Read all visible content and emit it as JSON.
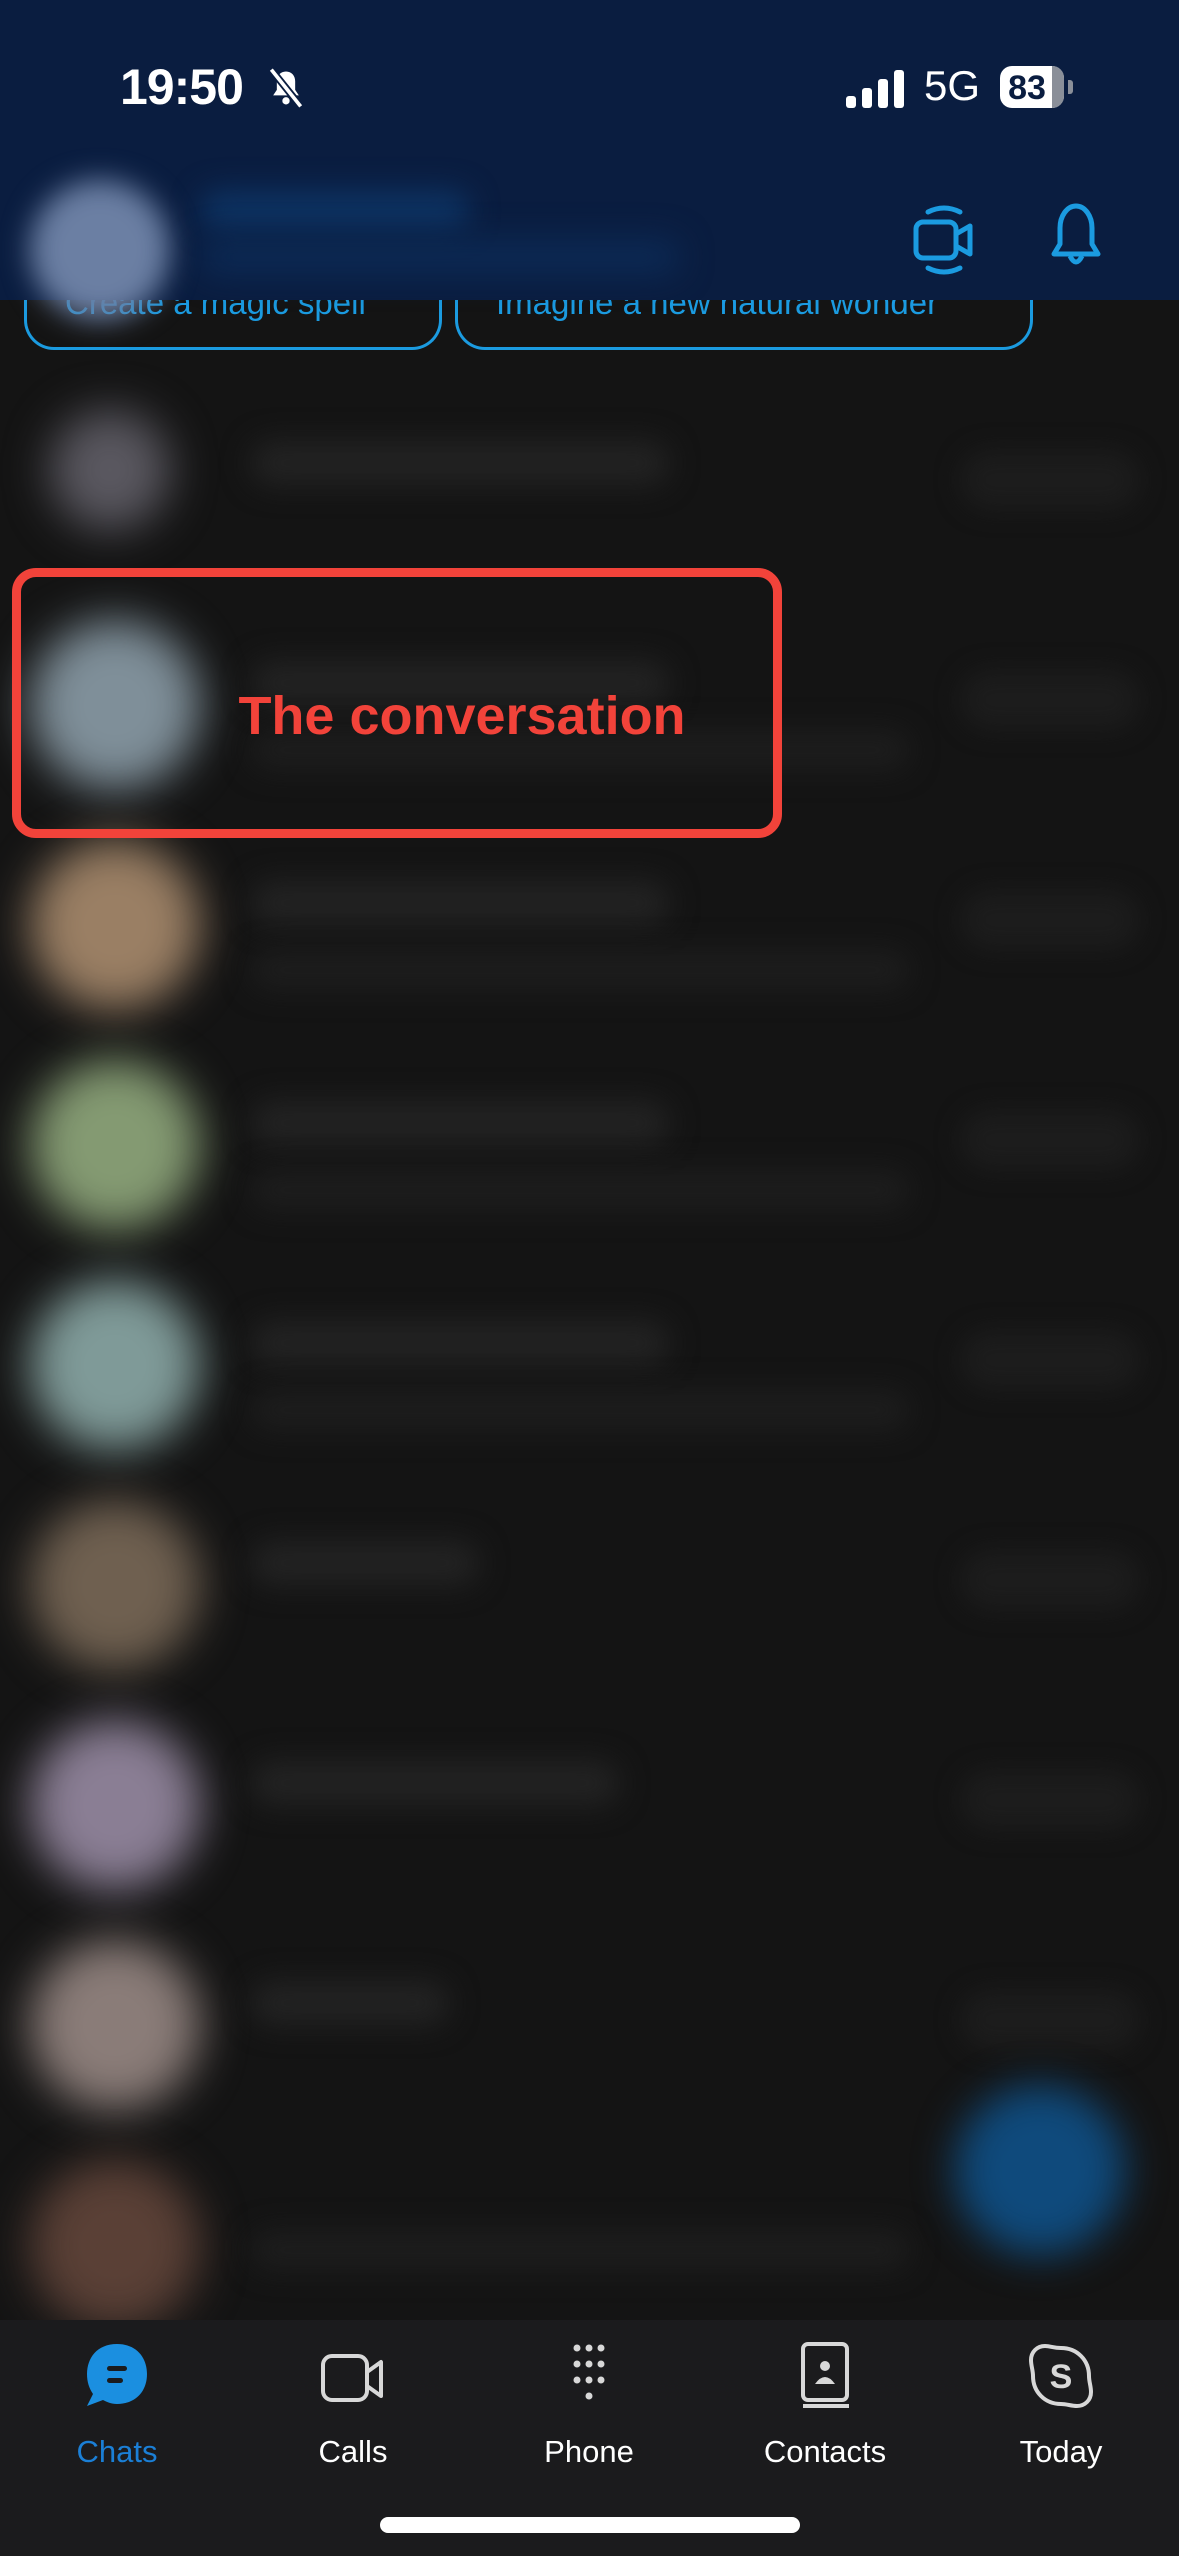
{
  "status_bar": {
    "time": "19:50",
    "silent_mode": true,
    "network": "5G",
    "signal_bars": 4,
    "battery_percent": "83"
  },
  "header": {
    "video_button_icon": "video-camera-ring-icon",
    "notifications_button_icon": "bell-icon"
  },
  "prompt_chips": [
    {
      "label": "Create a magic spell"
    },
    {
      "label": "Imagine a new natural wonder"
    }
  ],
  "chat_list": {
    "rows": [
      {
        "avatar_color": "#5a5860"
      },
      {
        "avatar_color": "#7f8f99"
      },
      {
        "avatar_color": "#9a7f64"
      },
      {
        "avatar_color": "#849a72"
      },
      {
        "avatar_color": "#7f9a98"
      },
      {
        "avatar_color": "#6f6050"
      },
      {
        "avatar_color": "#8a7e94"
      },
      {
        "avatar_color": "#8a7c78"
      },
      {
        "avatar_color": "#5a4036"
      }
    ]
  },
  "annotation": {
    "label": "The conversation",
    "color": "#f2433a"
  },
  "tab_bar": {
    "tabs": [
      {
        "label": "Chats",
        "icon": "chat-bubble-icon",
        "active": true
      },
      {
        "label": "Calls",
        "icon": "video-camera-icon",
        "active": false
      },
      {
        "label": "Phone",
        "icon": "dialpad-icon",
        "active": false
      },
      {
        "label": "Contacts",
        "icon": "contact-book-icon",
        "active": false
      },
      {
        "label": "Today",
        "icon": "skype-logo-icon",
        "active": false
      }
    ],
    "active_color": "#1b7fd6"
  },
  "colors": {
    "header_bg": "#0a1d40",
    "accent": "#1b9be0",
    "list_bg": "#141414",
    "tabbar_bg": "#1b1b1d"
  }
}
